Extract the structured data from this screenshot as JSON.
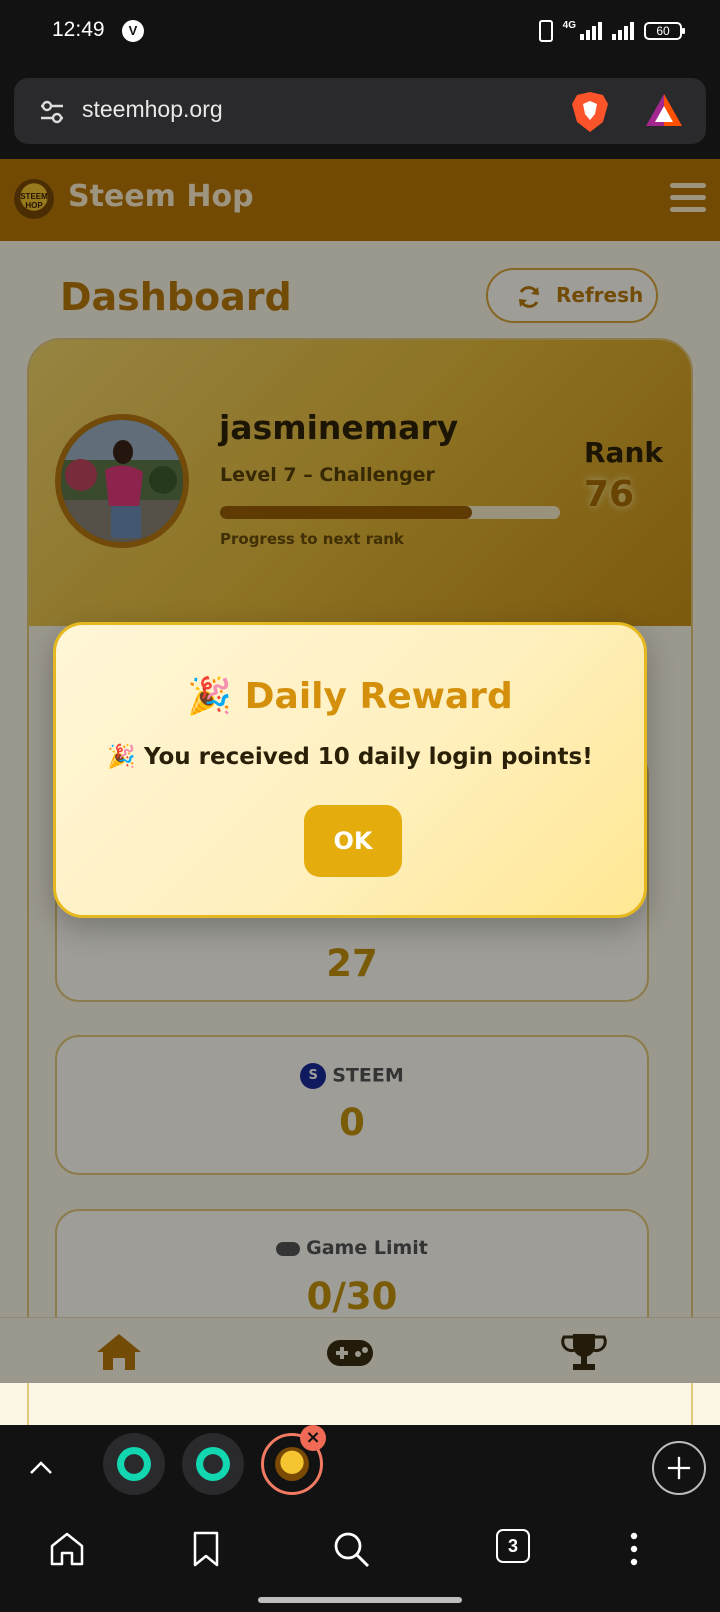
{
  "status_bar": {
    "time": "12:49",
    "v_badge": "V",
    "network": "4G",
    "battery": "60"
  },
  "browser": {
    "url": "steemhop.org",
    "tab_count": "3",
    "tabs": [
      "tab-1",
      "tab-2",
      "tab-steemhop"
    ]
  },
  "app": {
    "logo_text": "STEEM HOP",
    "title": "Steem Hop"
  },
  "dashboard": {
    "title": "Dashboard",
    "refresh_label": "Refresh",
    "username": "jasminemary",
    "level": "Level 7 – Challenger",
    "progress_label": "Progress to next rank",
    "progress_fraction": 0.74,
    "rank_label": "Rank",
    "rank_value": "76"
  },
  "stats": [
    {
      "label": "",
      "value": "27"
    },
    {
      "label": "STEEM",
      "value": "0",
      "icon": "steem-icon"
    },
    {
      "label": "Game Limit",
      "value": "0/30",
      "icon": "gamepad-icon"
    }
  ],
  "modal": {
    "title": "Daily Reward",
    "title_emoji": "🎉",
    "message": "You received 10 daily login points!",
    "message_emoji": "🎉",
    "ok_label": "OK"
  },
  "bottom_nav": [
    "home-icon",
    "gamepad-icon",
    "trophy-icon"
  ],
  "colors": {
    "header": "#b97806",
    "accent": "#c4930e",
    "modal_button": "#e5ac0e"
  }
}
